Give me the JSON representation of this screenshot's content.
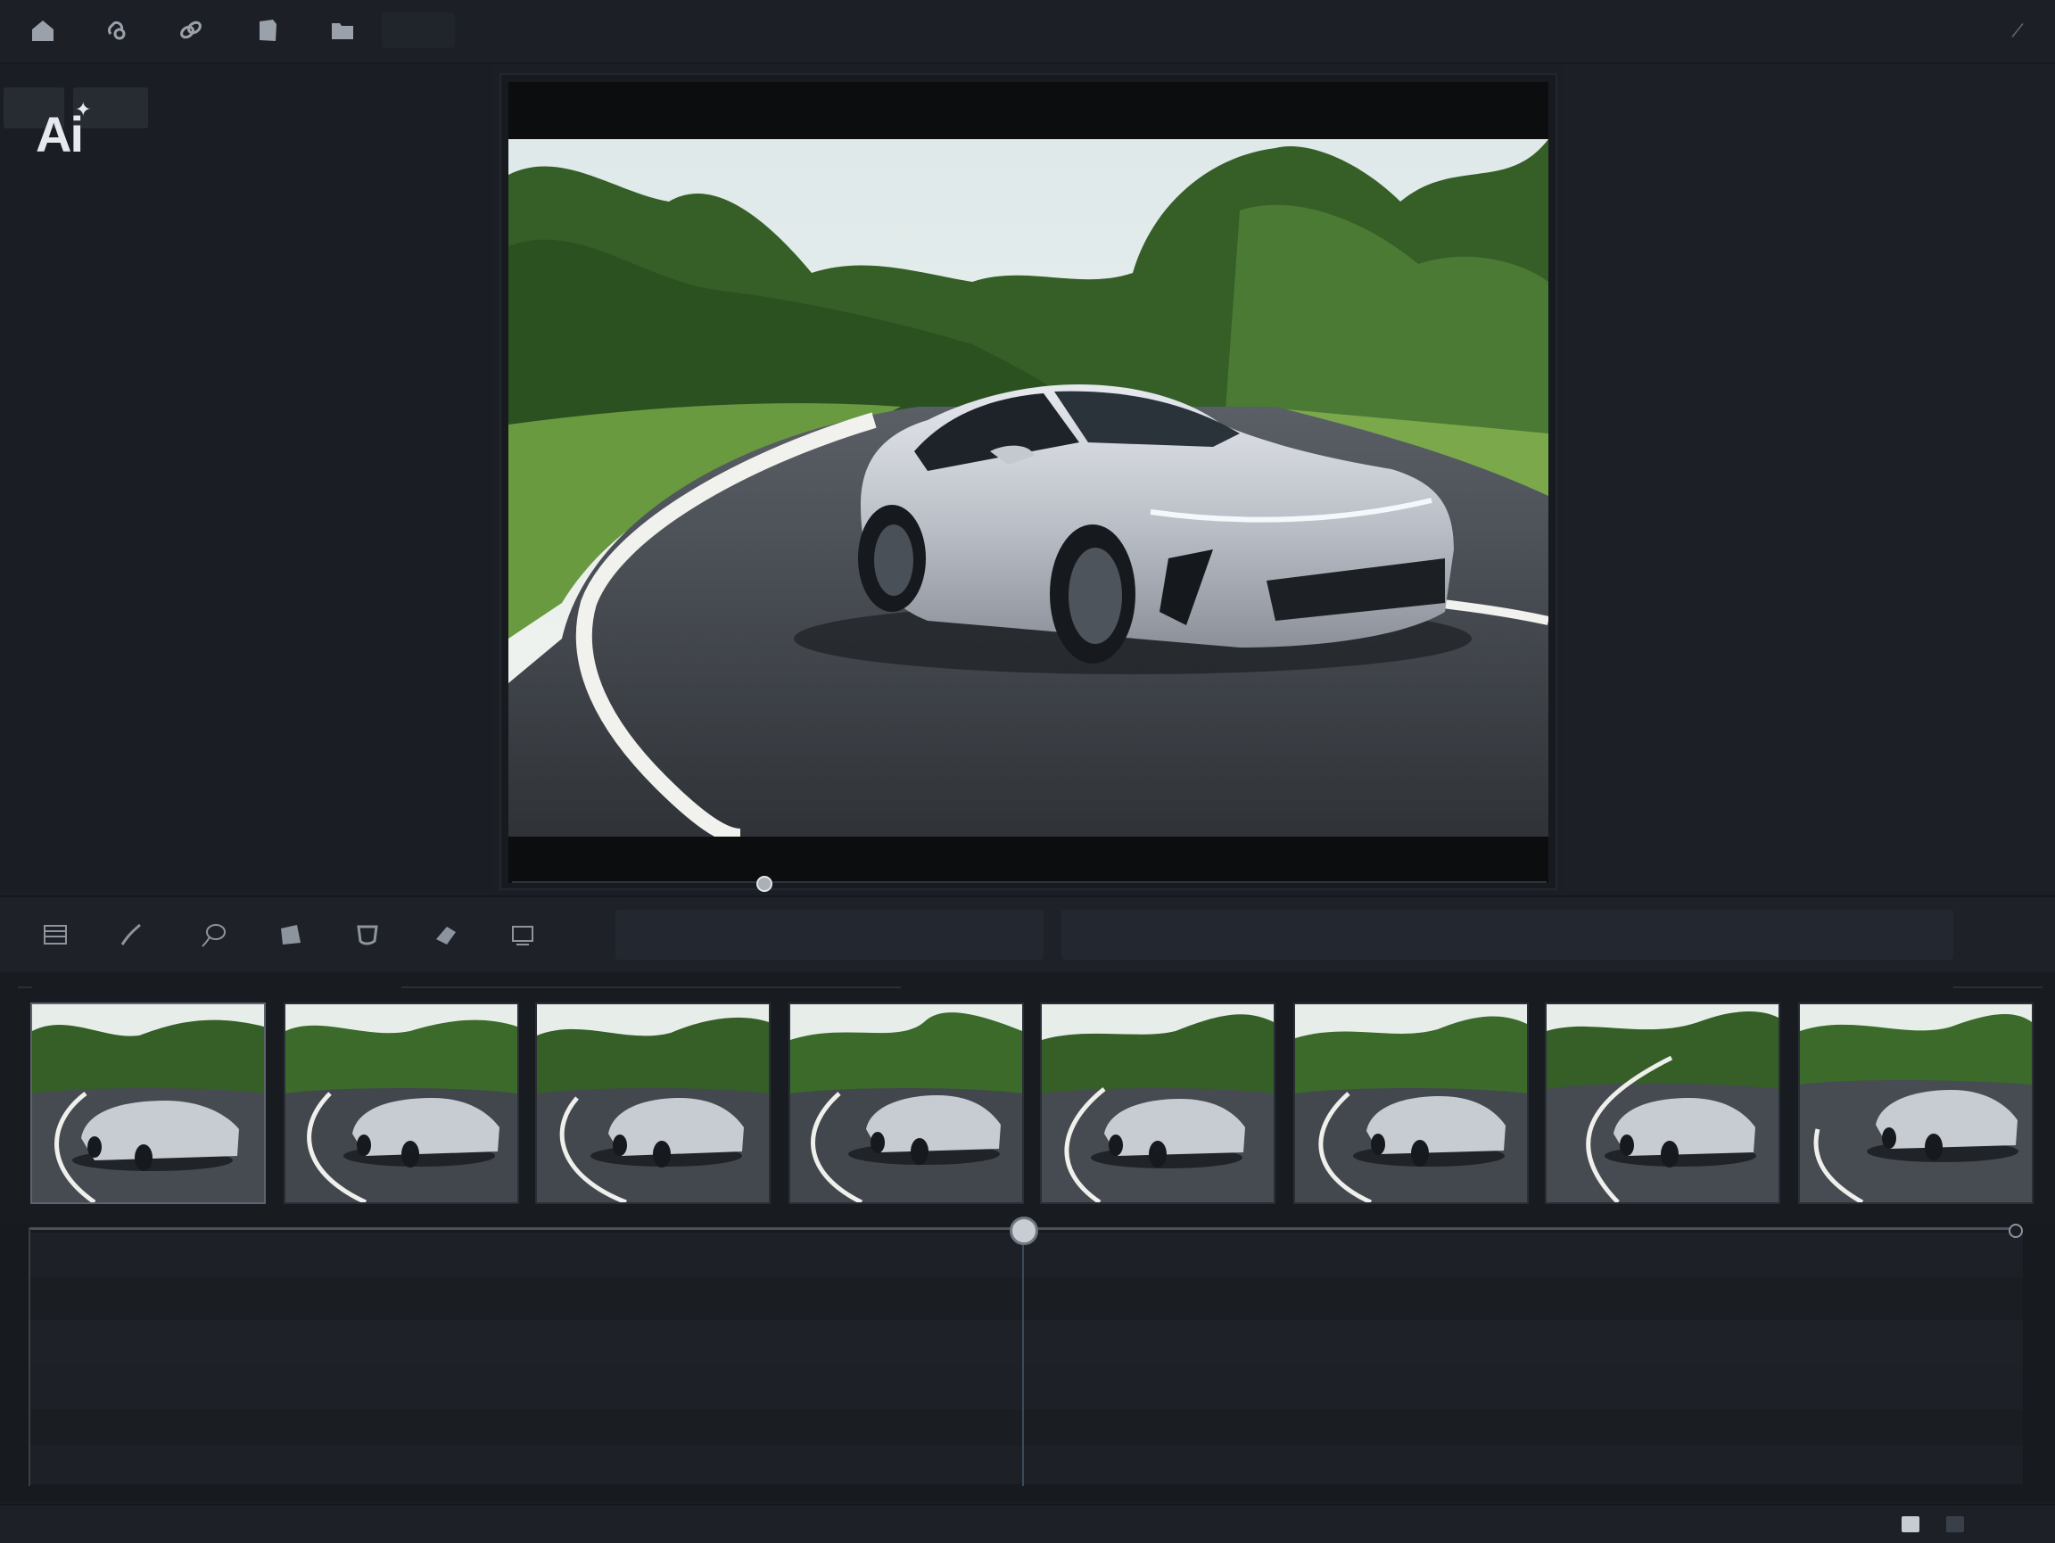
{
  "app": {
    "logo_text": "Ai",
    "logo_sparkle": "✦"
  },
  "top_toolbar": {
    "icons": [
      "home-icon",
      "link-icon",
      "chain-icon",
      "document-icon",
      "folder-icon"
    ],
    "right_icon": "edit-icon"
  },
  "tool_row": {
    "icons": [
      "layers-icon",
      "brush-icon",
      "lasso-icon",
      "crop-icon",
      "shape-icon",
      "eraser-icon",
      "frame-icon"
    ]
  },
  "filmstrip": {
    "frame_count": 8,
    "selected_index": 0
  },
  "timeline": {
    "playhead_fraction": 0.5,
    "tracks": 6
  },
  "colors": {
    "background": "#1b1f25",
    "panel": "#1e2228",
    "accent": "#c8cdd3",
    "car_body": "#c9ced6",
    "foliage": "#3f6e2c",
    "sky": "#e8efe9"
  }
}
